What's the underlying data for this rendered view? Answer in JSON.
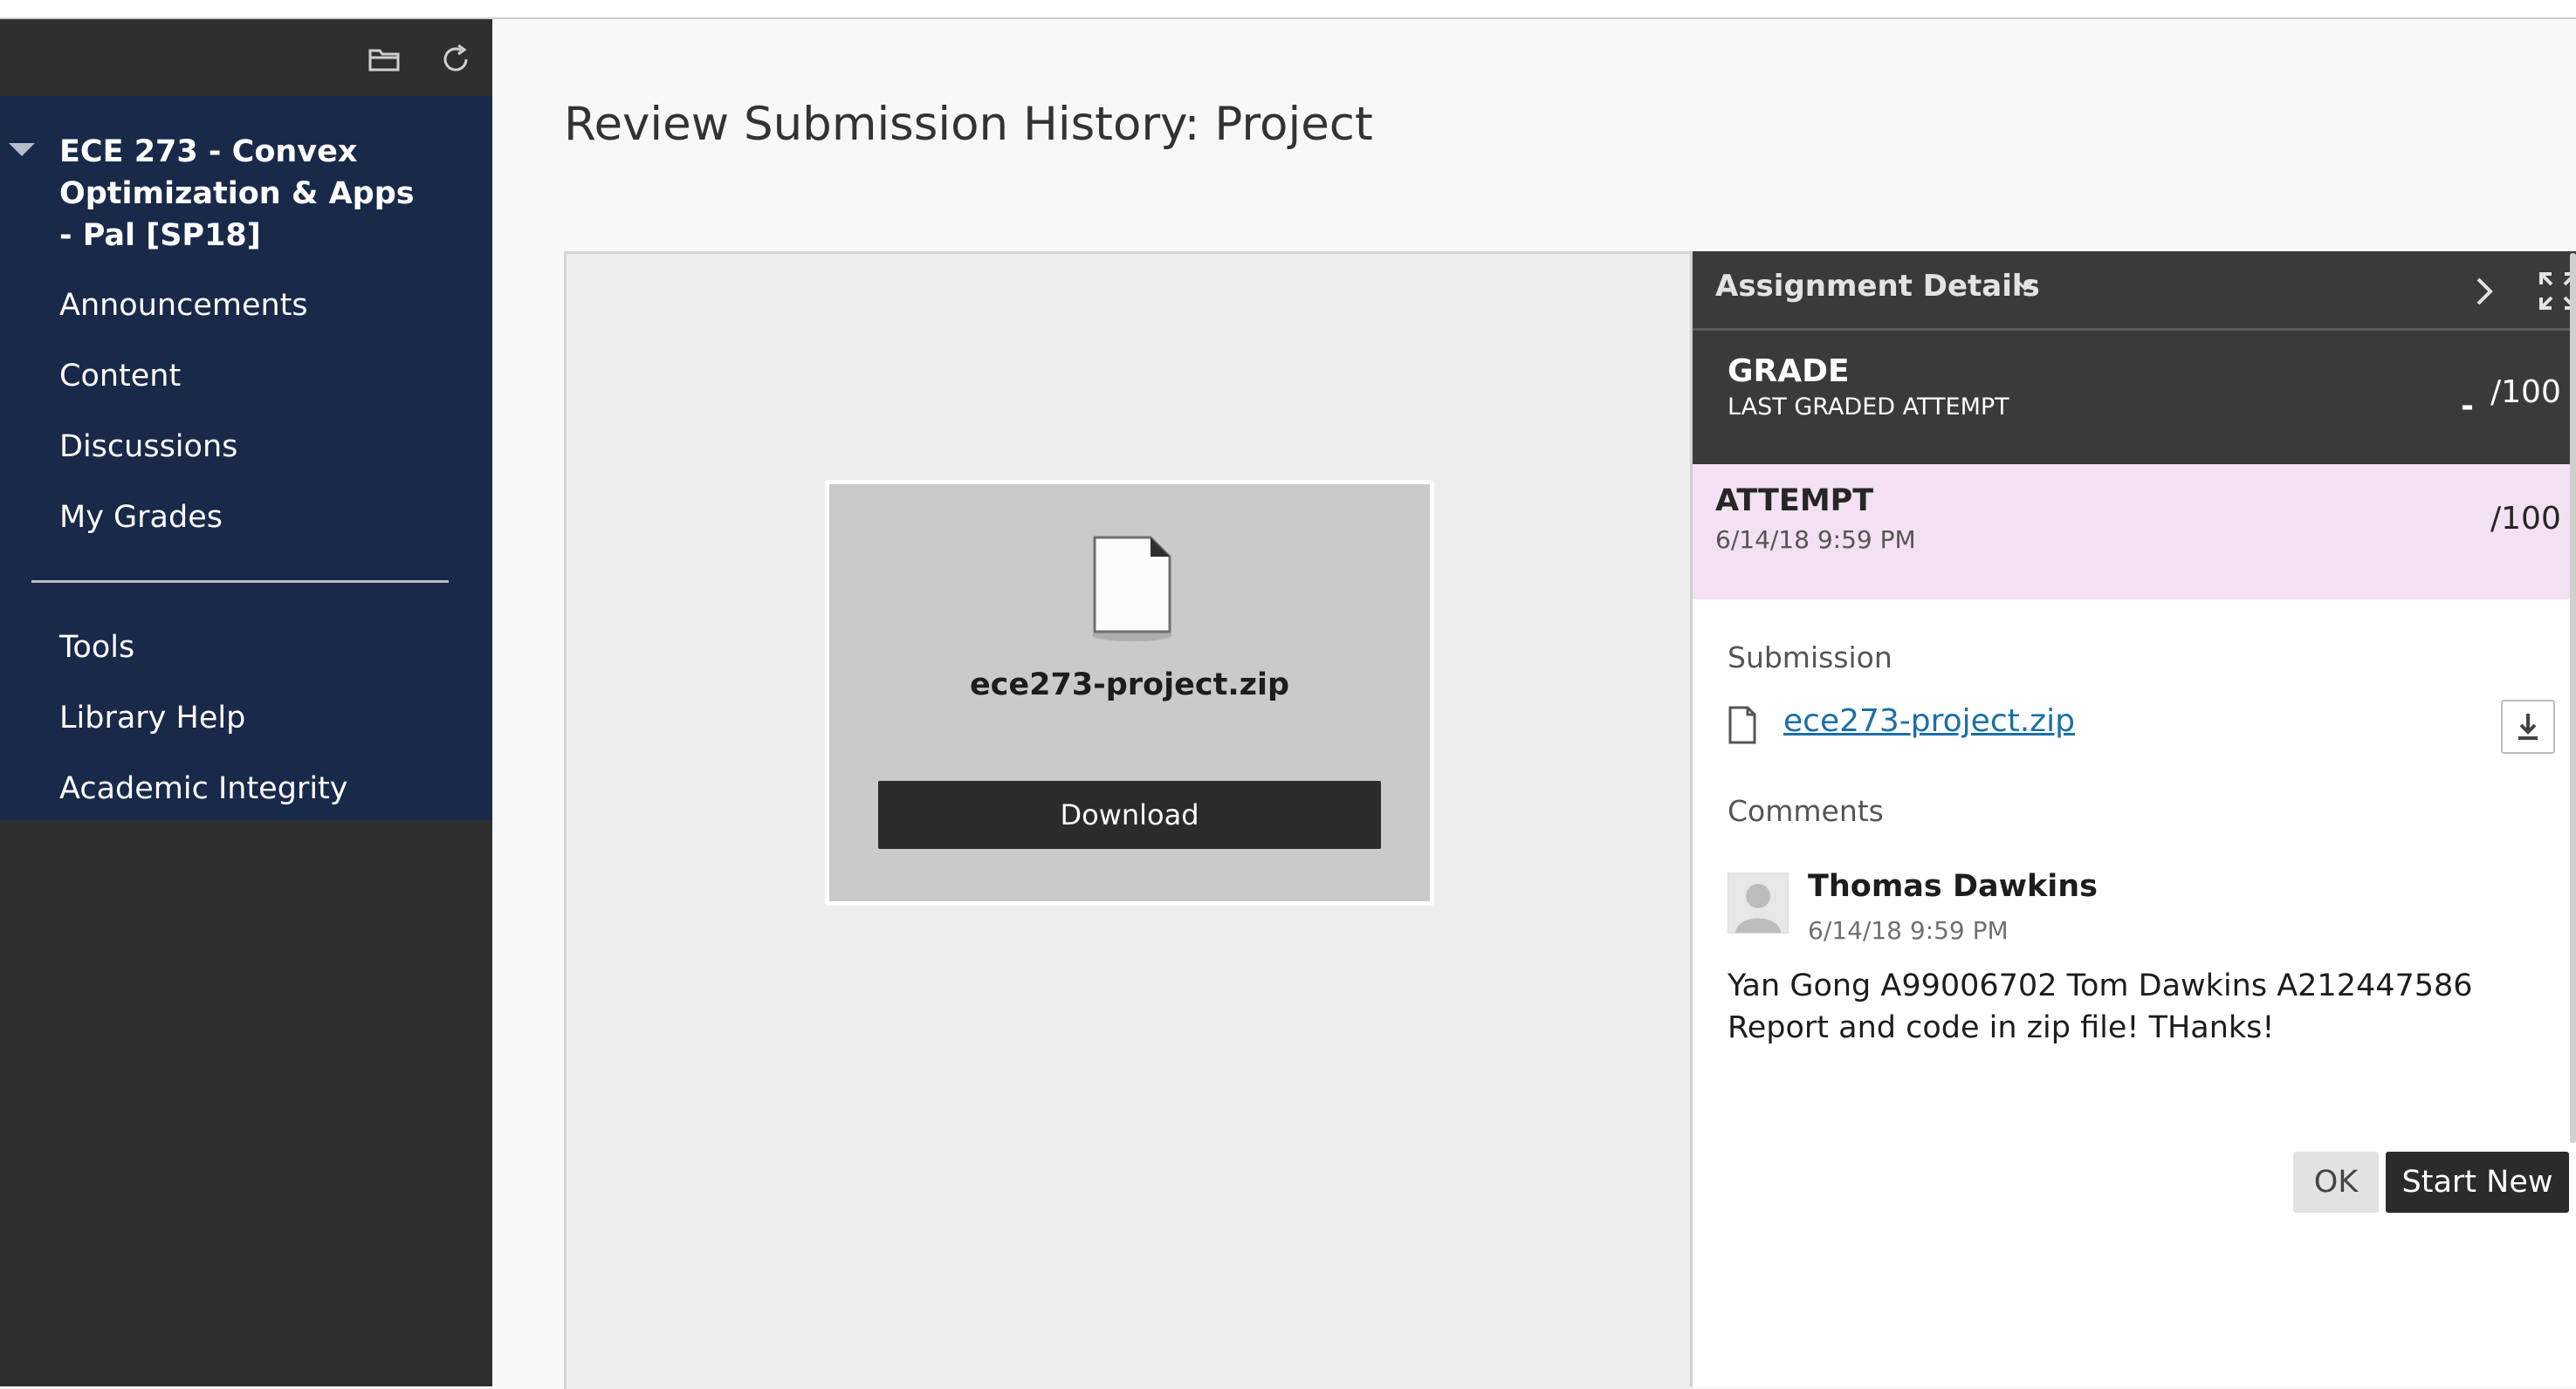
{
  "sidebar": {
    "toolbar": {
      "folder_icon": "folder-icon",
      "refresh_icon": "refresh-icon"
    },
    "course_title": "ECE 273 - Convex Optimization & Apps - Pal [SP18]",
    "items": [
      {
        "label": "Announcements"
      },
      {
        "label": "Content"
      },
      {
        "label": "Discussions"
      },
      {
        "label": "My Grades"
      }
    ],
    "items_secondary": [
      {
        "label": "Tools"
      },
      {
        "label": "Library Help"
      },
      {
        "label": "Academic Integrity"
      }
    ]
  },
  "page": {
    "title": "Review Submission History: Project"
  },
  "preview": {
    "file_name": "ece273-project.zip",
    "download_label": "Download"
  },
  "details": {
    "header_title": "Assignment Details",
    "grade": {
      "label": "GRADE",
      "sub_label": "LAST GRADED ATTEMPT",
      "score": "-",
      "out_of": "/100"
    },
    "attempt": {
      "label": "ATTEMPT",
      "date": "6/14/18 9:59 PM",
      "out_of": "/100"
    },
    "submission": {
      "label": "Submission",
      "file_name": "ece273-project.zip"
    },
    "comments": {
      "label": "Comments",
      "author": "Thomas Dawkins",
      "date": "6/14/18 9:59 PM",
      "text": "Yan Gong A99006702  Tom Dawkins A212447586  Report and code in zip file!  THanks!"
    },
    "buttons": {
      "ok": "OK",
      "start_new": "Start New"
    }
  },
  "colors": {
    "sidebar_menu_bg": "#19294a",
    "sidebar_bg": "#2f2f2f",
    "details_header_bg": "#3a3a3a",
    "attempt_bg": "#f3e0f2",
    "link": "#1b6fa8"
  }
}
